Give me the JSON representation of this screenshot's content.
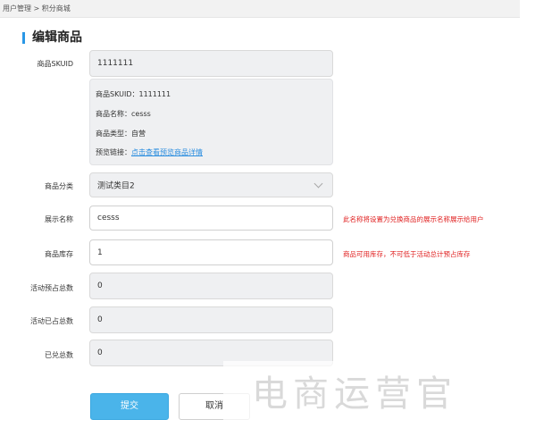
{
  "breadcrumb": {
    "text": "用户管理 > 积分商城"
  },
  "page_title": "编辑商品",
  "form": {
    "sku": {
      "label": "商品SKUID",
      "value": "1111111"
    },
    "info": {
      "sku_line": "商品SKUID：1111111",
      "name_line": "商品名称：cesss",
      "type_line": "商品类型：自营",
      "preview_label": "预览链接：",
      "preview_link": "点击查看预览商品详情"
    },
    "category": {
      "label": "商品分类",
      "value": "测试类目2"
    },
    "display_name": {
      "label": "展示名称",
      "value": "cesss",
      "hint": "此名称将设置为兑换商品的展示名称展示给用户"
    },
    "stock": {
      "label": "商品库存",
      "value": "1",
      "hint": "商品可用库存，不可低于活动总计预占库存"
    },
    "reserved_total": {
      "label": "活动预占总数",
      "value": "0"
    },
    "occupied_total": {
      "label": "活动已占总数",
      "value": "0"
    },
    "redeemed_total": {
      "label": "已兑总数",
      "value": "0"
    }
  },
  "buttons": {
    "submit": "提交",
    "cancel": "取消"
  },
  "watermark": {
    "text": "电商运营官"
  },
  "colors": {
    "accent": "#2a97e6",
    "submit": "#4ab4ea",
    "hint": "#e02020",
    "link": "#2a8ddf",
    "readonly_bg": "#eff0f2"
  }
}
